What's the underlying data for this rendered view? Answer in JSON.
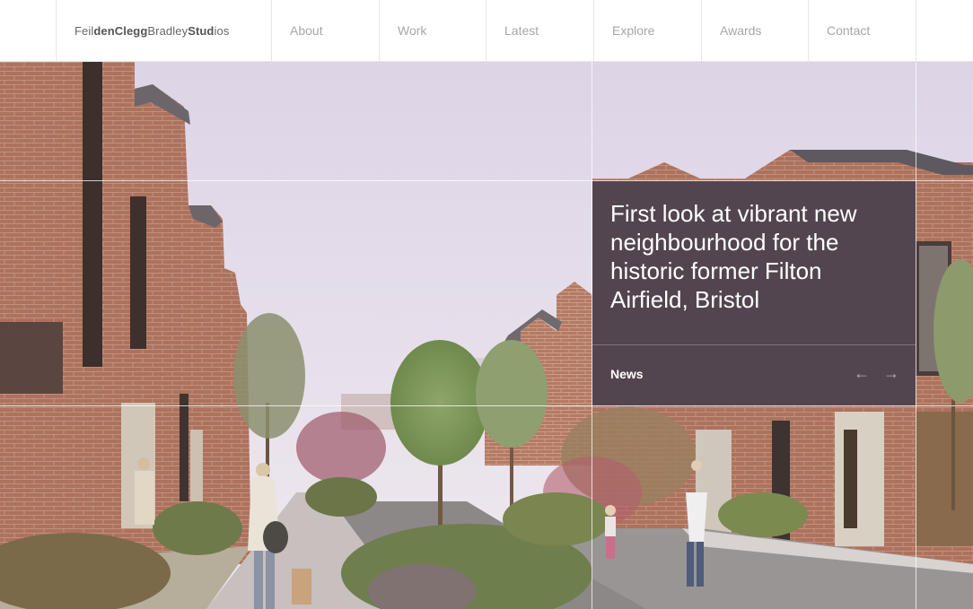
{
  "brand": {
    "parts": [
      "Feil",
      "den",
      "Clegg",
      "Bradley",
      "Stud",
      "i",
      "os"
    ]
  },
  "nav": {
    "items": [
      {
        "label": "About"
      },
      {
        "label": "Work"
      },
      {
        "label": "Latest"
      },
      {
        "label": "Explore"
      },
      {
        "label": "Awards"
      },
      {
        "label": "Contact"
      }
    ]
  },
  "hero": {
    "headline": "First look at vibrant new neighbourhood for the historic former Filton Airfield, Bristol",
    "category": "News",
    "prev_icon": "arrow-left-icon",
    "next_icon": "arrow-right-icon",
    "arrow_prev": "←",
    "arrow_next": "→"
  },
  "colors": {
    "card_bg": "#534550",
    "nav_text": "#a6a6a6",
    "brick": "#a9705a",
    "sky": "#e3dcea"
  }
}
